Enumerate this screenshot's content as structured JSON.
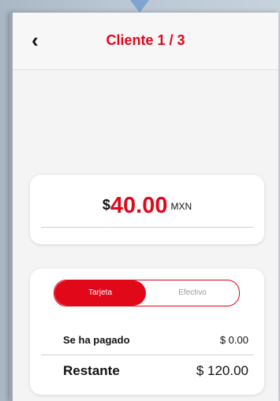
{
  "header": {
    "back_glyph": "‹",
    "title": "Cliente 1 / 3"
  },
  "amount": {
    "currency_symbol": "$",
    "value": "40.00",
    "currency_code": "MXN"
  },
  "payment": {
    "methods": [
      {
        "label": "Tarjeta",
        "selected": true
      },
      {
        "label": "Efectivo",
        "selected": false
      }
    ],
    "paid_label": "Se ha pagado",
    "paid_value": "$ 0.00",
    "remaining_label": "Restante",
    "remaining_value": "$ 120.00"
  },
  "colors": {
    "accent": "#e1081a",
    "background": "#f4f4f4",
    "card": "#ffffff"
  },
  "icons": {
    "back": "chevron-left-icon"
  }
}
